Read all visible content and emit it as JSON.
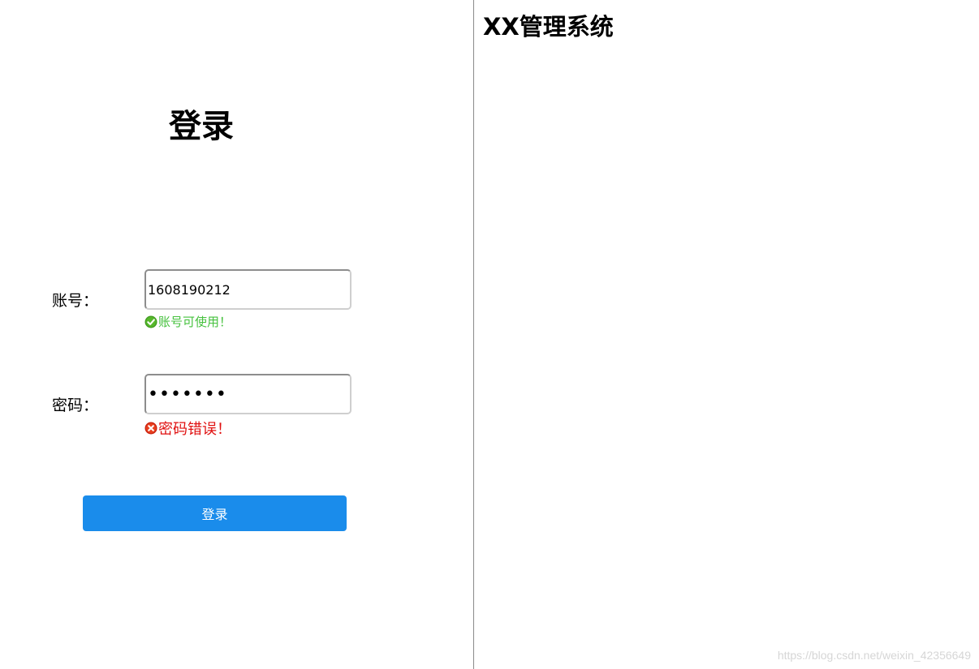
{
  "login_panel": {
    "heading": "登录",
    "account": {
      "label": "账号：",
      "value": "1608190212",
      "status_icon": "check-circle-icon",
      "status_text": "账号可使用！",
      "status_color": "#45c13d"
    },
    "password": {
      "label": "密码：",
      "value": "1234567",
      "status_icon": "error-circle-icon",
      "status_text": "密码错误！",
      "status_color": "#e01010"
    },
    "submit_label": "登录",
    "submit_color": "#1a8ceb"
  },
  "main_panel": {
    "title": "XX管理系统"
  },
  "watermark": "https://blog.csdn.net/weixin_42356649"
}
